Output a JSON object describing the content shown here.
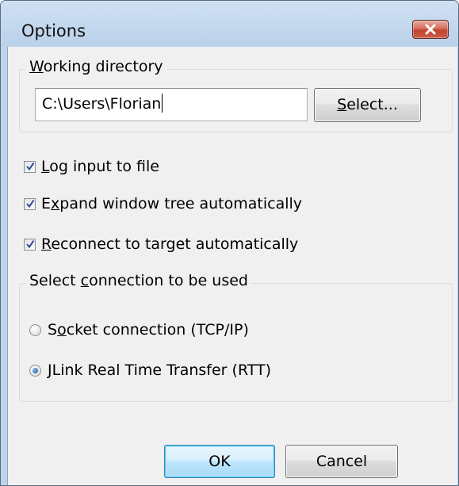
{
  "window": {
    "title": "Options"
  },
  "working_directory": {
    "legend_pre": "",
    "legend_access": "W",
    "legend_post": "orking directory",
    "path_value": "C:\\Users\\Florian",
    "select_pre": "",
    "select_access": "S",
    "select_post": "elect..."
  },
  "checkboxes": [
    {
      "pre": "",
      "access": "L",
      "post": "og input to file",
      "checked": true
    },
    {
      "pre": "E",
      "access": "x",
      "post": "pand window tree automatically",
      "checked": true
    },
    {
      "pre": "",
      "access": "R",
      "post": "econnect to target automatically",
      "checked": true
    }
  ],
  "connection": {
    "legend_pre": "Select ",
    "legend_access": "c",
    "legend_post": "onnection to be used",
    "options": [
      {
        "pre": "S",
        "access": "o",
        "post": "cket connection (TCP/IP)",
        "selected": false
      },
      {
        "pre": "",
        "access": "J",
        "post": "Link Real Time Transfer (RTT)",
        "selected": true
      }
    ]
  },
  "footer": {
    "ok_label": "OK",
    "cancel_label": "Cancel"
  },
  "colors": {
    "title_bar": "#bcd3ec",
    "close_button": "#c7412c",
    "dialog_background": "#f0f0f0",
    "default_button_border": "#3c7fb1"
  }
}
